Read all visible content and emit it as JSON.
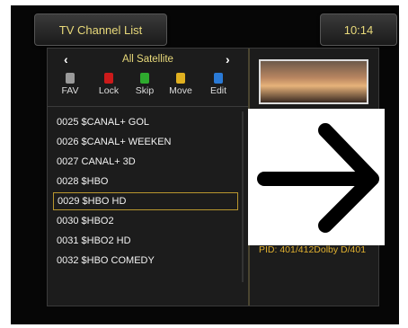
{
  "header": {
    "title": "TV Channel List",
    "time": "10:14"
  },
  "satellite": {
    "label": "All Satellite",
    "prev_icon": "chevron-left-icon",
    "next_icon": "chevron-right-icon"
  },
  "function_keys": [
    {
      "label": "FAV",
      "color": "#9a9a9a"
    },
    {
      "label": "Lock",
      "color": "#cc1a1a"
    },
    {
      "label": "Skip",
      "color": "#2eaa2e"
    },
    {
      "label": "Move",
      "color": "#e0b020"
    },
    {
      "label": "Edit",
      "color": "#2a7ad6"
    }
  ],
  "channels": [
    {
      "label": "0025 $CANAL+ GOL"
    },
    {
      "label": "0026 $CANAL+ WEEKEN"
    },
    {
      "label": "0027 CANAL+ 3D"
    },
    {
      "label": "0028 $HBO"
    },
    {
      "label": "0029 $HBO HD",
      "selected": true
    },
    {
      "label": "0030 $HBO2"
    },
    {
      "label": "0031 $HBO2 HD"
    },
    {
      "label": "0032 $HBO COMEDY"
    }
  ],
  "info": {
    "pid": "PID: 401/412Dolby D/401"
  },
  "overlay": {
    "icon": "arrow-right-icon",
    "color": "#000000"
  }
}
